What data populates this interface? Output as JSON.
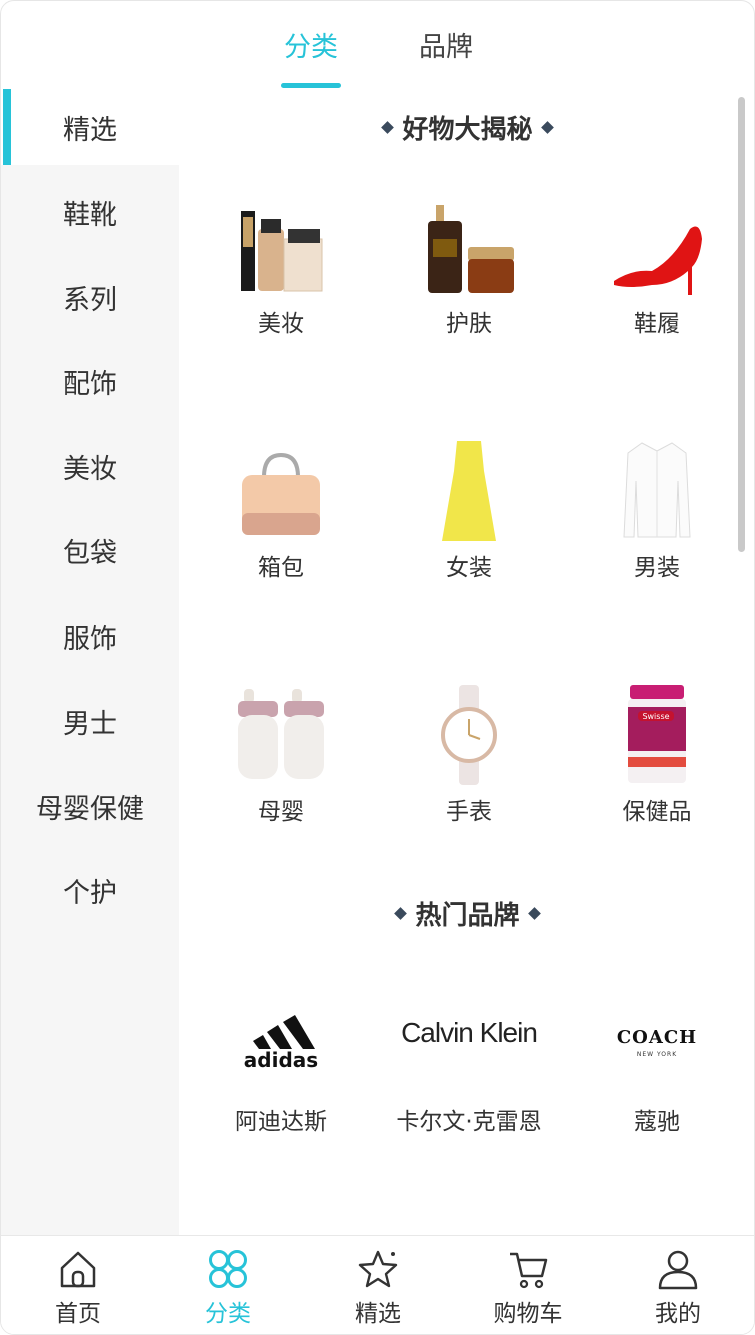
{
  "tabs": [
    {
      "label": "分类",
      "active": true
    },
    {
      "label": "品牌",
      "active": false
    }
  ],
  "sidebar": {
    "items": [
      {
        "label": "精选"
      },
      {
        "label": "鞋靴"
      },
      {
        "label": "系列"
      },
      {
        "label": "配饰"
      },
      {
        "label": "美妆"
      },
      {
        "label": "包袋"
      },
      {
        "label": "服饰"
      },
      {
        "label": "男士"
      },
      {
        "label": "母婴保健"
      },
      {
        "label": "个护"
      }
    ],
    "active_index": 0
  },
  "sections": {
    "goods": {
      "title": "好物大揭秘",
      "items": [
        {
          "label": "美妆",
          "icon": "makeup-products-image"
        },
        {
          "label": "护肤",
          "icon": "skincare-bottles-image"
        },
        {
          "label": "鞋履",
          "icon": "red-high-heel-image"
        },
        {
          "label": "箱包",
          "icon": "handbag-image"
        },
        {
          "label": "女装",
          "icon": "yellow-dress-image"
        },
        {
          "label": "男装",
          "icon": "white-shirt-image"
        },
        {
          "label": "母婴",
          "icon": "baby-bottles-image"
        },
        {
          "label": "手表",
          "icon": "wristwatch-image"
        },
        {
          "label": "保健品",
          "icon": "vitamin-jar-image"
        }
      ]
    },
    "brands": {
      "title": "热门品牌",
      "items": [
        {
          "label": "阿迪达斯",
          "logo_text": "adidas"
        },
        {
          "label": "卡尔文·克雷恩",
          "logo_text": "Calvin Klein"
        },
        {
          "label": "蔻驰",
          "logo_text": "COACH",
          "logo_sub": "NEW YORK"
        }
      ]
    }
  },
  "bottom_nav": [
    {
      "label": "首页",
      "icon": "home-icon"
    },
    {
      "label": "分类",
      "icon": "category-icon",
      "active": true
    },
    {
      "label": "精选",
      "icon": "star-icon"
    },
    {
      "label": "购物车",
      "icon": "cart-icon"
    },
    {
      "label": "我的",
      "icon": "user-icon"
    }
  ],
  "colors": {
    "accent": "#27c3d8",
    "sidebar_bg": "#f6f6f6",
    "text": "#333333"
  },
  "vitamin_jar_text": "Swisse"
}
